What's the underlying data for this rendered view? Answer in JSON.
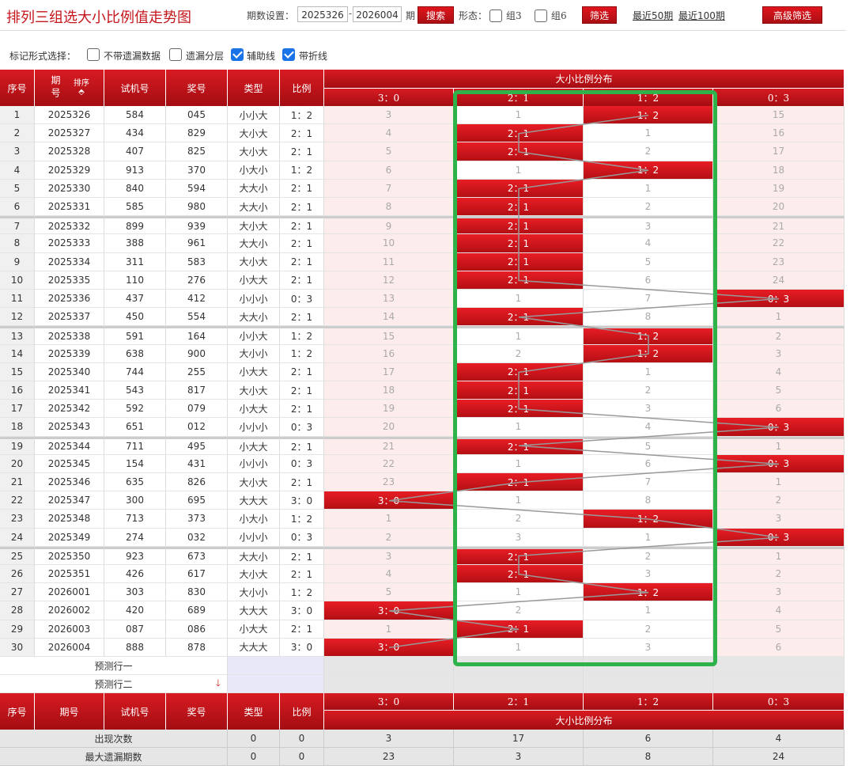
{
  "header": {
    "title": "排列三组选大小比例值走势图",
    "period_label": "期数设置：",
    "start_value": "2025326",
    "dash": "-",
    "end_value": "2026004",
    "period_unit": "期",
    "search_label": "搜索",
    "form_label": "形态：",
    "group3_label": "组3",
    "group6_label": "组6",
    "filter_label": "筛选",
    "recent50_label": "最近50期",
    "recent100_label": "最近100期",
    "advanced_label": "高级筛选"
  },
  "marks": {
    "label": "标记形式选择：",
    "no_missing_label": "不带遗漏数据",
    "missing_layer_label": "遗漏分层",
    "aux_line_label": "辅助线",
    "fold_line_label": "带折线",
    "no_missing_checked": false,
    "missing_layer_checked": false,
    "aux_line_checked": true,
    "fold_line_checked": true
  },
  "table": {
    "headers": {
      "seq": "序号",
      "period": "期号",
      "sort": "排序",
      "trial": "试机号",
      "prize": "奖号",
      "type": "类型",
      "ratio": "比例",
      "dist": "大小比例分布",
      "bins": [
        "3：0",
        "2：1",
        "1：2",
        "0：3"
      ]
    },
    "rows": [
      {
        "seq": "1",
        "period": "2025326",
        "trial": "584",
        "prize": "045",
        "type": "小小大",
        "ratio": "1：2",
        "dist": [
          "3",
          "1",
          "1：2",
          "15"
        ],
        "hit": 2
      },
      {
        "seq": "2",
        "period": "2025327",
        "trial": "434",
        "prize": "829",
        "type": "大小大",
        "ratio": "2：1",
        "dist": [
          "4",
          "2：1",
          "1",
          "16"
        ],
        "hit": 1
      },
      {
        "seq": "3",
        "period": "2025328",
        "trial": "407",
        "prize": "825",
        "type": "大小大",
        "ratio": "2：1",
        "dist": [
          "5",
          "2：1",
          "2",
          "17"
        ],
        "hit": 1
      },
      {
        "seq": "4",
        "period": "2025329",
        "trial": "913",
        "prize": "370",
        "type": "小大小",
        "ratio": "1：2",
        "dist": [
          "6",
          "1",
          "1：2",
          "18"
        ],
        "hit": 2
      },
      {
        "seq": "5",
        "period": "2025330",
        "trial": "840",
        "prize": "594",
        "type": "大大小",
        "ratio": "2：1",
        "dist": [
          "7",
          "2：1",
          "1",
          "19"
        ],
        "hit": 1
      },
      {
        "seq": "6",
        "period": "2025331",
        "trial": "585",
        "prize": "980",
        "type": "大大小",
        "ratio": "2：1",
        "dist": [
          "8",
          "2：1",
          "2",
          "20"
        ],
        "hit": 1
      },
      {
        "seq": "7",
        "period": "2025332",
        "trial": "899",
        "prize": "939",
        "type": "大小大",
        "ratio": "2：1",
        "dist": [
          "9",
          "2：1",
          "3",
          "21"
        ],
        "hit": 1
      },
      {
        "seq": "8",
        "period": "2025333",
        "trial": "388",
        "prize": "961",
        "type": "大大小",
        "ratio": "2：1",
        "dist": [
          "10",
          "2：1",
          "4",
          "22"
        ],
        "hit": 1
      },
      {
        "seq": "9",
        "period": "2025334",
        "trial": "311",
        "prize": "583",
        "type": "大小大",
        "ratio": "2：1",
        "dist": [
          "11",
          "2：1",
          "5",
          "23"
        ],
        "hit": 1
      },
      {
        "seq": "10",
        "period": "2025335",
        "trial": "110",
        "prize": "276",
        "type": "小大大",
        "ratio": "2：1",
        "dist": [
          "12",
          "2：1",
          "6",
          "24"
        ],
        "hit": 1
      },
      {
        "seq": "11",
        "period": "2025336",
        "trial": "437",
        "prize": "412",
        "type": "小小小",
        "ratio": "0：3",
        "dist": [
          "13",
          "1",
          "7",
          "0：3"
        ],
        "hit": 3
      },
      {
        "seq": "12",
        "period": "2025337",
        "trial": "450",
        "prize": "554",
        "type": "大大小",
        "ratio": "2：1",
        "dist": [
          "14",
          "2：1",
          "8",
          "1"
        ],
        "hit": 1
      },
      {
        "seq": "13",
        "period": "2025338",
        "trial": "591",
        "prize": "164",
        "type": "小小大",
        "ratio": "1：2",
        "dist": [
          "15",
          "1",
          "1：2",
          "2"
        ],
        "hit": 2
      },
      {
        "seq": "14",
        "period": "2025339",
        "trial": "638",
        "prize": "900",
        "type": "大小小",
        "ratio": "1：2",
        "dist": [
          "16",
          "2",
          "1：2",
          "3"
        ],
        "hit": 2
      },
      {
        "seq": "15",
        "period": "2025340",
        "trial": "744",
        "prize": "255",
        "type": "小大大",
        "ratio": "2：1",
        "dist": [
          "17",
          "2：1",
          "1",
          "4"
        ],
        "hit": 1
      },
      {
        "seq": "16",
        "period": "2025341",
        "trial": "543",
        "prize": "817",
        "type": "大小大",
        "ratio": "2：1",
        "dist": [
          "18",
          "2：1",
          "2",
          "5"
        ],
        "hit": 1
      },
      {
        "seq": "17",
        "period": "2025342",
        "trial": "592",
        "prize": "079",
        "type": "小大大",
        "ratio": "2：1",
        "dist": [
          "19",
          "2：1",
          "3",
          "6"
        ],
        "hit": 1
      },
      {
        "seq": "18",
        "period": "2025343",
        "trial": "651",
        "prize": "012",
        "type": "小小小",
        "ratio": "0：3",
        "dist": [
          "20",
          "1",
          "4",
          "0：3"
        ],
        "hit": 3
      },
      {
        "seq": "19",
        "period": "2025344",
        "trial": "711",
        "prize": "495",
        "type": "小大大",
        "ratio": "2：1",
        "dist": [
          "21",
          "2：1",
          "5",
          "1"
        ],
        "hit": 1
      },
      {
        "seq": "20",
        "period": "2025345",
        "trial": "154",
        "prize": "431",
        "type": "小小小",
        "ratio": "0：3",
        "dist": [
          "22",
          "1",
          "6",
          "0：3"
        ],
        "hit": 3
      },
      {
        "seq": "21",
        "period": "2025346",
        "trial": "635",
        "prize": "826",
        "type": "大小大",
        "ratio": "2：1",
        "dist": [
          "23",
          "2：1",
          "7",
          "1"
        ],
        "hit": 1
      },
      {
        "seq": "22",
        "period": "2025347",
        "trial": "300",
        "prize": "695",
        "type": "大大大",
        "ratio": "3：0",
        "dist": [
          "3：0",
          "1",
          "8",
          "2"
        ],
        "hit": 0
      },
      {
        "seq": "23",
        "period": "2025348",
        "trial": "713",
        "prize": "373",
        "type": "小大小",
        "ratio": "1：2",
        "dist": [
          "1",
          "2",
          "1：2",
          "3"
        ],
        "hit": 2
      },
      {
        "seq": "24",
        "period": "2025349",
        "trial": "274",
        "prize": "032",
        "type": "小小小",
        "ratio": "0：3",
        "dist": [
          "2",
          "3",
          "1",
          "0：3"
        ],
        "hit": 3
      },
      {
        "seq": "25",
        "period": "2025350",
        "trial": "923",
        "prize": "673",
        "type": "大大小",
        "ratio": "2：1",
        "dist": [
          "3",
          "2：1",
          "2",
          "1"
        ],
        "hit": 1
      },
      {
        "seq": "26",
        "period": "2025351",
        "trial": "426",
        "prize": "617",
        "type": "大小大",
        "ratio": "2：1",
        "dist": [
          "4",
          "2：1",
          "3",
          "2"
        ],
        "hit": 1
      },
      {
        "seq": "27",
        "period": "2026001",
        "trial": "303",
        "prize": "830",
        "type": "大小小",
        "ratio": "1：2",
        "dist": [
          "5",
          "1",
          "1：2",
          "3"
        ],
        "hit": 2
      },
      {
        "seq": "28",
        "period": "2026002",
        "trial": "420",
        "prize": "689",
        "type": "大大大",
        "ratio": "3：0",
        "dist": [
          "3：0",
          "2",
          "1",
          "4"
        ],
        "hit": 0
      },
      {
        "seq": "29",
        "period": "2026003",
        "trial": "087",
        "prize": "086",
        "type": "小大大",
        "ratio": "2：1",
        "dist": [
          "1",
          "2：1",
          "2",
          "5"
        ],
        "hit": 1
      },
      {
        "seq": "30",
        "period": "2026004",
        "trial": "888",
        "prize": "878",
        "type": "大大大",
        "ratio": "3：0",
        "dist": [
          "3：0",
          "1",
          "3",
          "6"
        ],
        "hit": 0
      }
    ],
    "predict1": "预测行一",
    "predict2": "预测行二",
    "footer_headers": {
      "seq": "序号",
      "period": "期号",
      "trial": "试机号",
      "prize": "奖号",
      "type": "类型",
      "ratio": "比例",
      "bins": [
        "3：0",
        "2：1",
        "1：2",
        "0：3"
      ],
      "dist": "大小比例分布"
    },
    "summary": [
      {
        "label": "出现次数",
        "type": "0",
        "ratio": "0",
        "values": [
          "3",
          "17",
          "6",
          "4"
        ]
      },
      {
        "label": "最大遗漏期数",
        "type": "0",
        "ratio": "0",
        "values": [
          "23",
          "3",
          "8",
          "24"
        ]
      }
    ]
  },
  "colors": {
    "accent_red": "#c4161c",
    "highlight_green": "#2db34a",
    "row_pink": "#fdecec",
    "checkbox_blue": "#1b73e8"
  }
}
